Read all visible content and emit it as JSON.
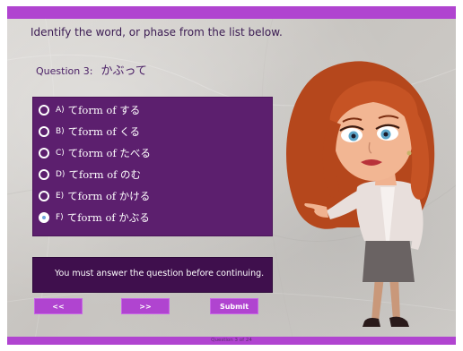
{
  "instruction": "Identify the word, or phase from the list below.",
  "question": {
    "label": "Question 3:",
    "word": "かぶって"
  },
  "options": [
    {
      "letter": "A)",
      "text": "てform of する",
      "selected": false
    },
    {
      "letter": "B)",
      "text": "てform of くる",
      "selected": false
    },
    {
      "letter": "C)",
      "text": "てform of たべる",
      "selected": false
    },
    {
      "letter": "D)",
      "text": "てform of のむ",
      "selected": false
    },
    {
      "letter": "E)",
      "text": "てform of かける",
      "selected": false
    },
    {
      "letter": "F)",
      "text": "てform of かぶる",
      "selected": true
    }
  ],
  "message": "You must answer the question before continuing.",
  "buttons": {
    "prev": "<<",
    "next": ">>",
    "submit": "Submit"
  },
  "footer": "Question 3 of 24",
  "colors": {
    "accent": "#b044d0",
    "panel": "#5c1f6e",
    "message_panel": "#3f0f4d",
    "text_heading": "#3a1a52"
  },
  "icons": {
    "radio_unselected": "radio-empty-icon",
    "radio_selected": "radio-filled-icon"
  }
}
